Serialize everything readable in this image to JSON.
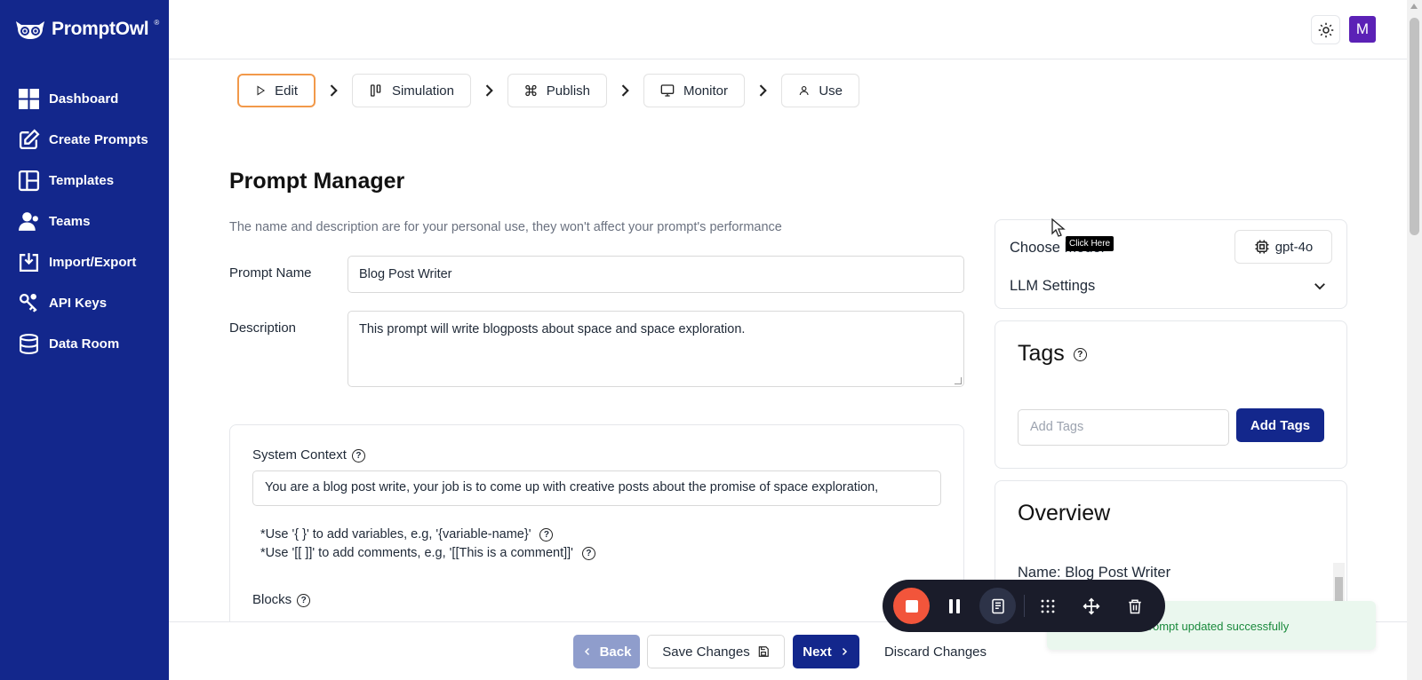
{
  "brand": {
    "name": "PromptOwl",
    "reg": "®"
  },
  "sidebar": {
    "items": [
      {
        "label": "Dashboard",
        "icon": "grid-icon"
      },
      {
        "label": "Create Prompts",
        "icon": "edit-icon"
      },
      {
        "label": "Templates",
        "icon": "layout-icon"
      },
      {
        "label": "Teams",
        "icon": "users-icon"
      },
      {
        "label": "Import/Export",
        "icon": "download-icon"
      },
      {
        "label": "API Keys",
        "icon": "key-icon"
      },
      {
        "label": "Data Room",
        "icon": "database-icon"
      }
    ]
  },
  "topbar": {
    "avatar_initial": "M"
  },
  "steps": [
    {
      "label": "Edit",
      "icon": "play-icon",
      "active": true
    },
    {
      "label": "Simulation",
      "icon": "columns-icon"
    },
    {
      "label": "Publish",
      "icon": "command-icon"
    },
    {
      "label": "Monitor",
      "icon": "monitor-icon"
    },
    {
      "label": "Use",
      "icon": "user-icon"
    }
  ],
  "main": {
    "title": "Prompt Manager",
    "subtitle": "The name and description are for your personal use, they won't affect your prompt's performance",
    "prompt_name_label": "Prompt Name",
    "prompt_name_value": "Blog Post Writer",
    "description_label": "Description",
    "description_value": "This prompt will write blogposts about space and space exploration.",
    "system_context_label": "System Context",
    "system_context_value": "You are a blog post write, your job is to come up with creative posts about the promise of space exploration,",
    "note_variables": "*Use '{ }' to add variables, e.g, '{variable-name}'",
    "note_comments": "*Use '[[ ]]' to add comments, e.g, '[[This is a comment]]'",
    "blocks_label": "Blocks"
  },
  "right": {
    "choose_model_label": "Choose Model",
    "model_value": "gpt-4o",
    "llm_settings_label": "LLM Settings",
    "tooltip": "Click Here",
    "tags_title": "Tags",
    "tags_placeholder": "Add Tags",
    "add_tags_button": "Add Tags",
    "overview_title": "Overview",
    "overview_name_label": "Name:",
    "overview_name_value": "Blog Post Writer"
  },
  "actions": {
    "back": "Back",
    "save": "Save Changes",
    "next": "Next",
    "discard": "Discard Changes"
  },
  "toast": {
    "text": "Prompt updated successfully"
  },
  "colors": {
    "sidebar": "#13278c",
    "primary": "#13278c",
    "active_step_border": "#f2994a",
    "record": "#f2553b",
    "toast_bg": "#eaf7ee"
  }
}
